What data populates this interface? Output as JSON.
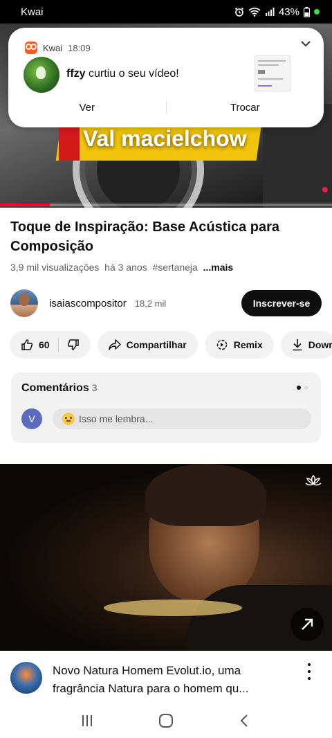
{
  "status_bar": {
    "app": "Kwai",
    "battery": "43%"
  },
  "player": {
    "overlay_text": "Val macielchow",
    "progress": 0.15
  },
  "notification": {
    "app_name": "Kwai",
    "time": "18:09",
    "user": "ffzy",
    "message": " curtiu o seu vídeo!",
    "actions": [
      "Ver",
      "Trocar"
    ]
  },
  "video": {
    "title": "Toque de Inspiração: Base Acústica para Composição",
    "views": "3,9 mil visualizações",
    "age": "há 3 anos",
    "hashtag": "#sertaneja",
    "more": "...mais"
  },
  "channel": {
    "name": "isaiascompositor",
    "subscribers": "18,2 mil",
    "subscribe_label": "Inscrever-se"
  },
  "actions": {
    "likes": "60",
    "share_label": "Compartilhar",
    "remix_label": "Remix",
    "download_label": "Down"
  },
  "comments": {
    "title": "Comentários",
    "count": "3",
    "user_initial": "V",
    "placeholder": "Isso me lembra..."
  },
  "next_video": {
    "title": "Novo Natura Homem Evolut.io, uma fragrância Natura para o homem qu..."
  },
  "colors": {
    "accent_red": "#ff0033",
    "subscribe_bg": "#0f0f0f",
    "comment_avatar": "#5c6bc0"
  }
}
